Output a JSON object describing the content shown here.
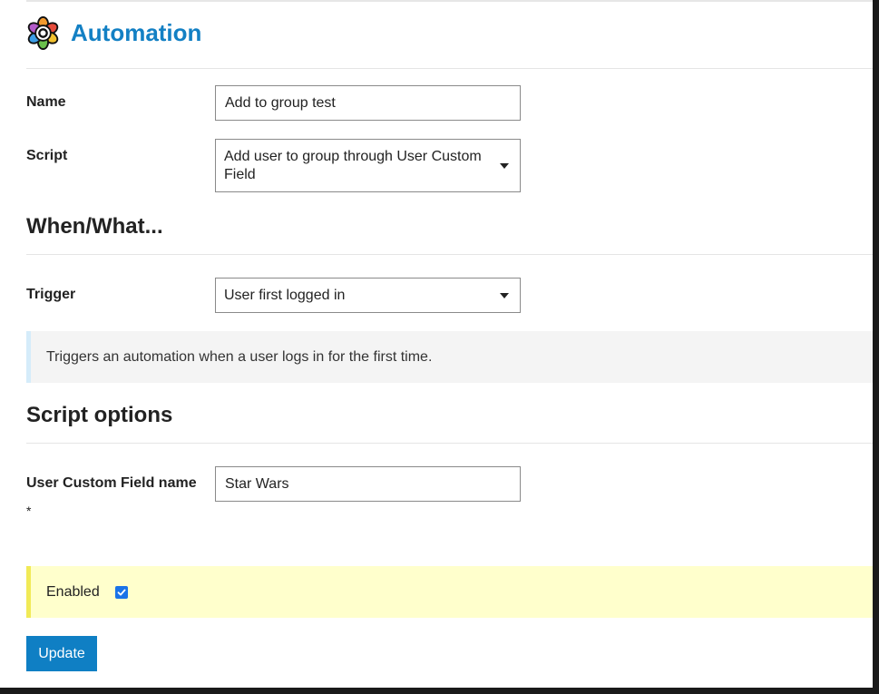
{
  "page": {
    "title": "Automation",
    "logo_icon": "flower-gear-icon"
  },
  "form": {
    "name": {
      "label": "Name",
      "value": "Add to group test"
    },
    "script": {
      "label": "Script",
      "value": "Add user to group through User Custom Field"
    }
  },
  "when_what": {
    "heading": "When/What...",
    "trigger": {
      "label": "Trigger",
      "value": "User first logged in"
    },
    "info": "Triggers an automation when a user logs in for the first time."
  },
  "script_options": {
    "heading": "Script options",
    "custom_field": {
      "label": "User Custom Field name",
      "value": "Star Wars",
      "required_mark": "*"
    }
  },
  "enabled": {
    "label": "Enabled",
    "checked": true
  },
  "actions": {
    "update_label": "Update"
  },
  "colors": {
    "accent": "#1380c4",
    "button": "#0f7fc4",
    "info_border": "#d5ecfa",
    "enabled_bg": "#ffffcc",
    "enabled_border": "#f1ea57"
  }
}
